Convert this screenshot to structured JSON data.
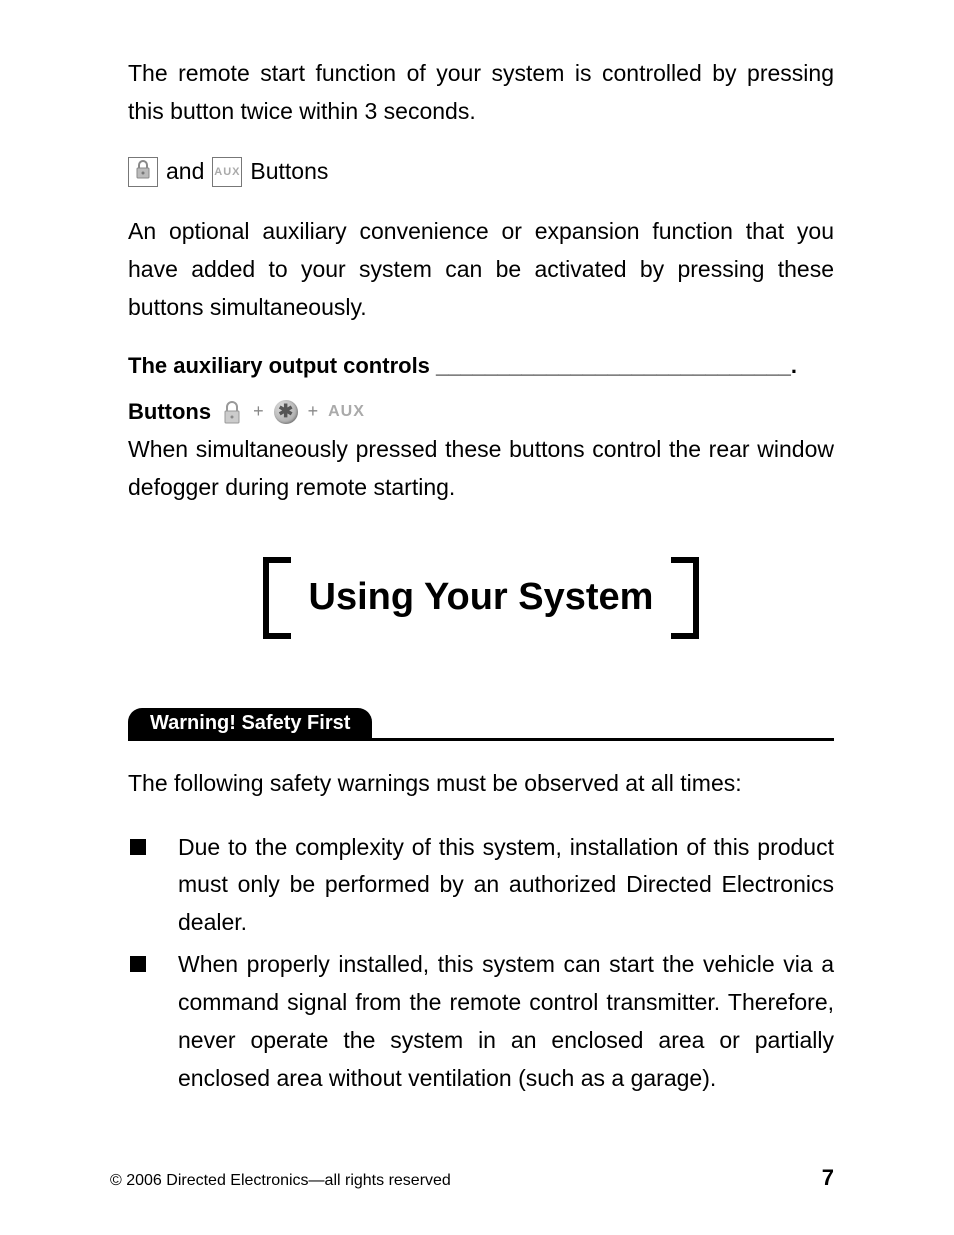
{
  "intro_paragraph": "The remote start function of your system is controlled by pressing this button twice within 3 seconds.",
  "icons_line": {
    "and": "and",
    "buttons": "Buttons"
  },
  "aux_paragraph": "An optional auxiliary convenience or expansion function that you have added to your system can be activated by pressing these buttons simultaneously.",
  "aux_controls_line": "The auxiliary output controls _____________________________.",
  "buttons_label": "Buttons",
  "defogger_paragraph": "When simultaneously pressed these buttons control the rear window defogger during remote starting.",
  "section_title": "Using Your System",
  "warning_label": "Warning! Safety First",
  "warning_intro": "The following safety warnings must be observed at all times:",
  "bullets": [
    "Due to the complexity of this system, installation of this product must only be performed by an authorized Directed Electronics dealer.",
    "When properly installed, this system can start the vehicle via a command signal from the remote control transmitter. Therefore, never operate the system in an enclosed area or partially enclosed area without ventilation (such as a garage)."
  ],
  "footer": {
    "copyright": "© 2006 Directed Electronics—all rights reserved",
    "page": "7"
  },
  "icons": {
    "lock": "lock-icon",
    "aux": "AUX",
    "star": "✱"
  }
}
